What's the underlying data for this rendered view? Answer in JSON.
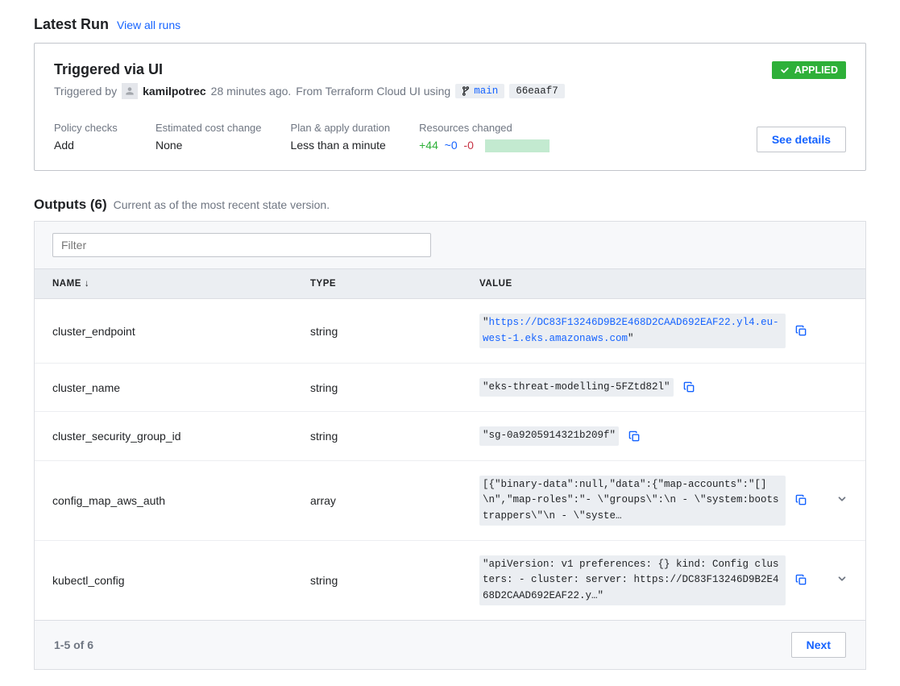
{
  "latest_run": {
    "section_title": "Latest Run",
    "view_all": "View all runs",
    "card_title": "Triggered via UI",
    "triggered_by_prefix": "Triggered by",
    "user": "kamilpotrec",
    "when": "28 minutes ago.",
    "from_text": "From Terraform Cloud UI using",
    "branch": "main",
    "commit": "66eaaf7",
    "status": "APPLIED",
    "meta": {
      "policy_label": "Policy checks",
      "policy_value": "Add",
      "cost_label": "Estimated cost change",
      "cost_value": "None",
      "duration_label": "Plan & apply duration",
      "duration_value": "Less than a minute",
      "resources_label": "Resources changed",
      "res_add": "+44",
      "res_change": "~0",
      "res_del": "-0"
    },
    "details_button": "See details"
  },
  "outputs": {
    "title": "Outputs (6)",
    "subtitle": "Current as of the most recent state version.",
    "filter_placeholder": "Filter",
    "headers": {
      "name": "NAME",
      "type": "TYPE",
      "value": "VALUE"
    },
    "rows": [
      {
        "name": "cluster_endpoint",
        "type": "string",
        "value_prefix": "\"",
        "value_link": "https://DC83F13246D9B2E468D2CAAD692EAF22.yl4.eu-west-1.eks.amazonaws.com",
        "value_suffix": "\"",
        "is_link": true,
        "expandable": false
      },
      {
        "name": "cluster_name",
        "type": "string",
        "value": "\"eks-threat-modelling-5FZtd82l\"",
        "expandable": false
      },
      {
        "name": "cluster_security_group_id",
        "type": "string",
        "value": "\"sg-0a9205914321b209f\"",
        "expandable": false
      },
      {
        "name": "config_map_aws_auth",
        "type": "array",
        "value": "[{\"binary-data\":null,\"data\":{\"map-accounts\":\"[]\\n\",\"map-roles\":\"- \\\"groups\\\":\\n - \\\"system:bootstrappers\\\"\\n - \\\"syste…",
        "expandable": true
      },
      {
        "name": "kubectl_config",
        "type": "string",
        "value": "\"apiVersion: v1 preferences: {} kind: Config clusters: - cluster: server: https://DC83F13246D9B2E468D2CAAD692EAF22.y…\"",
        "expandable": true
      }
    ],
    "pager_info": "1-5 of 6",
    "next_label": "Next"
  }
}
